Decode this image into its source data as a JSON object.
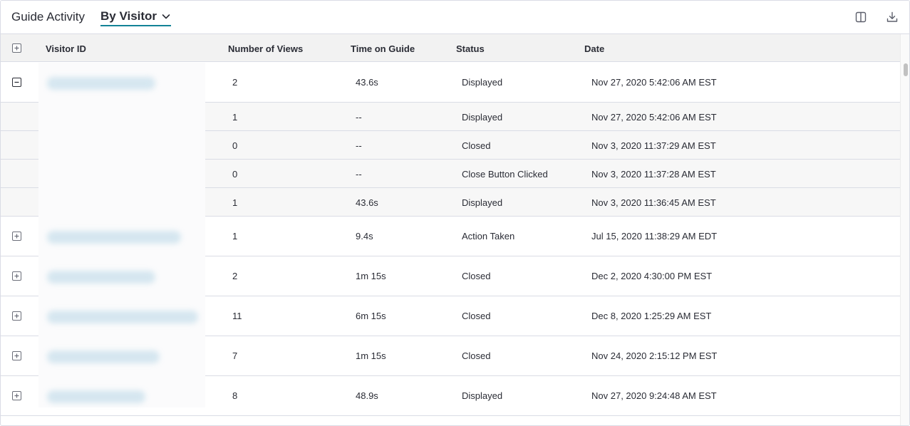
{
  "header": {
    "title": "Guide Activity",
    "view_selector": "By Visitor",
    "icons": [
      "chevron-down-icon",
      "columns-icon",
      "download-icon"
    ]
  },
  "columns": [
    "Visitor ID",
    "Number of Views",
    "Time on Guide",
    "Status",
    "Date"
  ],
  "rows": [
    {
      "kind": "main",
      "expanded": true,
      "views": "2",
      "time": "43.6s",
      "status": "Displayed",
      "date": "Nov 27, 2020 5:42:06 AM EST"
    },
    {
      "kind": "sub",
      "views": "1",
      "time": "--",
      "status": "Displayed",
      "date": "Nov 27, 2020 5:42:06 AM EST"
    },
    {
      "kind": "sub",
      "views": "0",
      "time": "--",
      "status": "Closed",
      "date": "Nov 3, 2020 11:37:29 AM EST"
    },
    {
      "kind": "sub",
      "views": "0",
      "time": "--",
      "status": "Close Button Clicked",
      "date": "Nov 3, 2020 11:37:28 AM EST"
    },
    {
      "kind": "sub",
      "views": "1",
      "time": "43.6s",
      "status": "Displayed",
      "date": "Nov 3, 2020 11:36:45 AM EST"
    },
    {
      "kind": "main",
      "expanded": false,
      "views": "1",
      "time": "9.4s",
      "status": "Action Taken",
      "date": "Jul 15, 2020 11:38:29 AM EDT"
    },
    {
      "kind": "main",
      "expanded": false,
      "views": "2",
      "time": "1m 15s",
      "status": "Closed",
      "date": "Dec 2, 2020 4:30:00 PM EST"
    },
    {
      "kind": "main",
      "expanded": false,
      "views": "11",
      "time": "6m 15s",
      "status": "Closed",
      "date": "Dec 8, 2020 1:25:29 AM EST"
    },
    {
      "kind": "main",
      "expanded": false,
      "views": "7",
      "time": "1m 15s",
      "status": "Closed",
      "date": "Nov 24, 2020 2:15:12 PM EST"
    },
    {
      "kind": "main",
      "expanded": false,
      "views": "8",
      "time": "48.9s",
      "status": "Displayed",
      "date": "Nov 27, 2020 9:24:48 AM EST"
    }
  ],
  "colors": {
    "accent": "#128297",
    "border": "#dadce5",
    "header_bg": "#f2f2f2",
    "subrow_bg": "#f7f7f7",
    "text": "#2a2c35"
  }
}
